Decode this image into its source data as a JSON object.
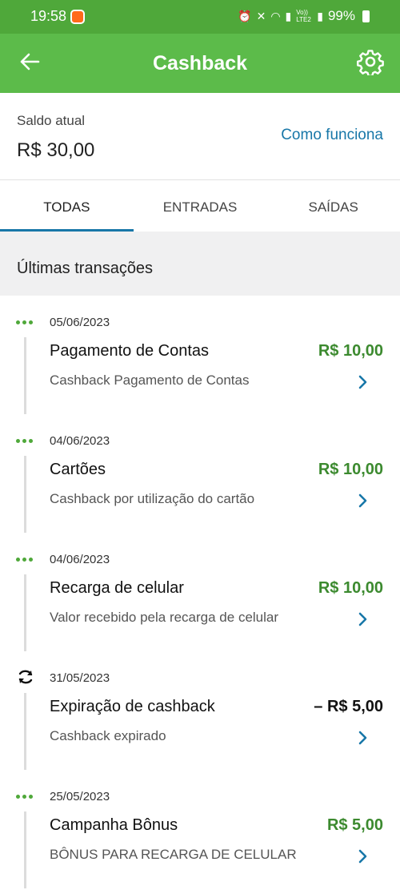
{
  "status": {
    "time": "19:58",
    "battery": "99%",
    "volte": "Vo)) LTE2"
  },
  "app_bar": {
    "title": "Cashback",
    "back_icon": "arrow-left-icon",
    "settings_icon": "gear-icon"
  },
  "balance": {
    "label": "Saldo atual",
    "value": "R$ 30,00",
    "link": "Como funciona"
  },
  "tabs": [
    {
      "label": "TODAS",
      "active": true
    },
    {
      "label": "ENTRADAS",
      "active": false
    },
    {
      "label": "SAÍDAS",
      "active": false
    }
  ],
  "section_title": "Últimas transações",
  "transactions": [
    {
      "date": "05/06/2023",
      "title": "Pagamento de Contas",
      "amount": "R$ 10,00",
      "description": "Cashback Pagamento de Contas",
      "icon": "dots-icon"
    },
    {
      "date": "04/06/2023",
      "title": "Cartões",
      "amount": "R$ 10,00",
      "description": "Cashback por utilização do cartão",
      "icon": "dots-icon"
    },
    {
      "date": "04/06/2023",
      "title": "Recarga de celular",
      "amount": "R$ 10,00",
      "description": "Valor recebido pela recarga de celular",
      "icon": "dots-icon"
    },
    {
      "date": "31/05/2023",
      "title": "Expiração de cashback",
      "amount": "– R$ 5,00",
      "description": "Cashback expirado",
      "icon": "refresh-icon"
    },
    {
      "date": "25/05/2023",
      "title": "Campanha Bônus",
      "amount": "R$ 5,00",
      "description": "BÔNUS PARA RECARGA DE CELULAR",
      "icon": "dots-icon"
    }
  ],
  "colors": {
    "primary_green": "#5cbb4a",
    "status_green": "#4fa83a",
    "amount_green": "#3c8a2f",
    "link_blue": "#1877a8"
  }
}
